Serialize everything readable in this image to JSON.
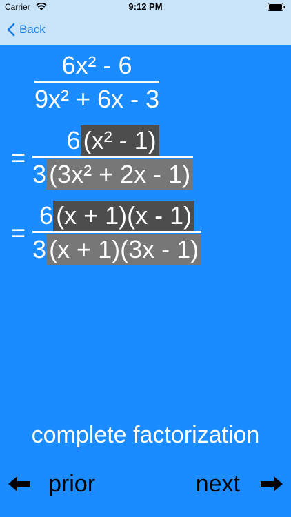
{
  "status": {
    "carrier": "Carrier",
    "time": "9:12 PM"
  },
  "nav": {
    "back_label": "Back"
  },
  "math": {
    "original": {
      "numerator": "6x² - 6",
      "denominator": "9x² + 6x - 3"
    },
    "step1": {
      "equals": "=",
      "numerator_coeff": "6",
      "numerator_factor": "(x² - 1)",
      "denominator_coeff": "3",
      "denominator_factor": "(3x² + 2x - 1)"
    },
    "step2": {
      "equals": "=",
      "numerator_coeff": "6",
      "numerator_factor": "(x + 1)(x - 1)",
      "denominator_coeff": "3",
      "denominator_factor": "(x + 1)(3x - 1)"
    }
  },
  "caption": "complete factorization",
  "controls": {
    "prior_label": "prior",
    "next_label": "next"
  },
  "colors": {
    "background": "#1a8cff",
    "navbar": "#c9e4f8",
    "highlight_dark": "#4d4d4d",
    "highlight_mid": "#777777"
  }
}
